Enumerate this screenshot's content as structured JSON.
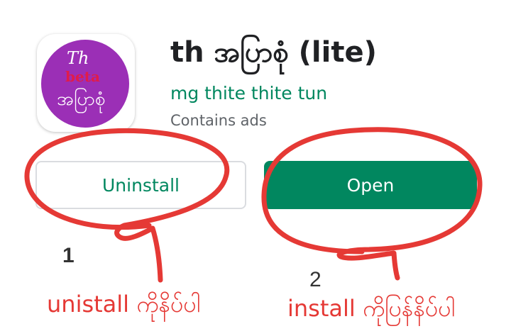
{
  "app": {
    "icon_text_top": "Th",
    "icon_text_mid": "beta",
    "icon_text_bottom": "အပြာစုံ",
    "title": "th အပြာစုံ (lite)",
    "developer": "mg thite thite tun",
    "contains_ads": "Contains ads"
  },
  "buttons": {
    "uninstall_label": "Uninstall",
    "open_label": "Open"
  },
  "annotations": {
    "marker_1": "1",
    "marker_2": "2",
    "note_left": "unistall ကိုနိပ်ပါ",
    "note_right": "install ကိုပြန်နိပ်ပါ"
  },
  "colors": {
    "brand_green": "#01875f",
    "icon_purple": "#9b2fb6",
    "annotation_red": "#e53935"
  }
}
